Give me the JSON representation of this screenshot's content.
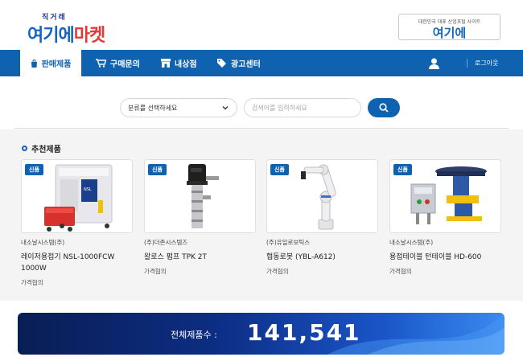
{
  "header": {
    "logo_sub": "직거래",
    "logo_main_a": "여기에",
    "logo_main_b": "마켓",
    "partner_sub": "대한민국 대표 산업포털 사이트",
    "partner_main": "여기에"
  },
  "nav": {
    "items": [
      {
        "label": "판매제품",
        "icon": "shopping-bag-icon"
      },
      {
        "label": "구매문의",
        "icon": "cart-icon"
      },
      {
        "label": "내상점",
        "icon": "store-icon"
      },
      {
        "label": "광고센터",
        "icon": "tags-icon"
      }
    ],
    "user_icon": "user-icon",
    "logout": "로그아웃"
  },
  "search": {
    "category_label": "분류를 선택하세요",
    "placeholder": "검색어를 입력하세요"
  },
  "recommended": {
    "title": "추천제품",
    "products": [
      {
        "badge": "신품",
        "company": "내소날시스템(주)",
        "name": "레이저용접기 NSL-1000FCW 1000W",
        "price": "가격협의"
      },
      {
        "badge": "신품",
        "company": "(주)더존시스템즈",
        "name": "왈로스 펌프 TPK 2T",
        "price": "가격협의"
      },
      {
        "badge": "신품",
        "company": "(주)유일로보틱스",
        "name": "협동로봇 (YBL-A612)",
        "price": "가격협의"
      },
      {
        "badge": "신품",
        "company": "내소날시스템(주)",
        "name": "용접테이블 턴테이블 HD-600",
        "price": "가격협의"
      }
    ]
  },
  "total": {
    "label": "전체제품수 :",
    "count": "141,541"
  },
  "colors": {
    "primary": "#0f62b0",
    "accent_red": "#e53935"
  }
}
